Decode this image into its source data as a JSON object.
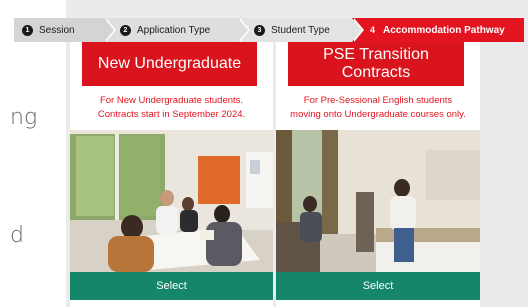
{
  "background_fragments": {
    "line1": "ng",
    "line2": "d"
  },
  "stepper": {
    "steps": [
      {
        "number": "1",
        "label": "Session"
      },
      {
        "number": "2",
        "label": "Application Type"
      },
      {
        "number": "3",
        "label": "Student Type"
      },
      {
        "number": "4",
        "label": "Accommodation Pathway",
        "active": true
      }
    ],
    "active_color": "#e3141f"
  },
  "cards": [
    {
      "title": "New Undergraduate",
      "description_line1": "For New Undergraduate students.",
      "description_line2": "Contracts start in September 2024.",
      "select_label": "Select"
    },
    {
      "title_line1": "PSE Transition",
      "title_line2": "Contracts",
      "description_line1": "For Pre-Sessional English students",
      "description_line2": "moving onto Undergraduate courses only.",
      "select_label": "Select"
    }
  ],
  "colors": {
    "brand_red": "#d9141d",
    "select_green": "#15866a"
  }
}
